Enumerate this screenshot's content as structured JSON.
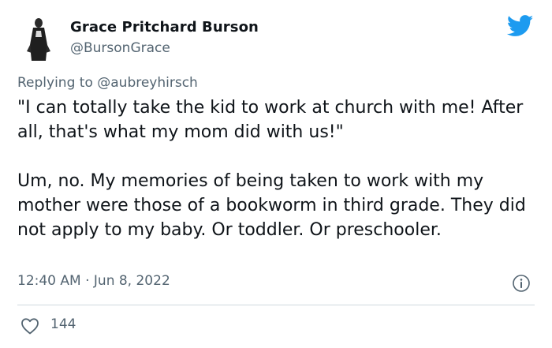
{
  "author": {
    "name": "Grace Pritchard Burson",
    "handle": "@BursonGrace"
  },
  "reply": {
    "prefix": "Replying to ",
    "mention": "@aubreyhirsch"
  },
  "tweet": {
    "paragraph_1": "\"I can totally take the kid to work at church with me! After all, that's what my mom did with us!\"",
    "paragraph_2": "Um, no. My memories of being taken to work with my mother were those of a bookworm in third grade. They did not apply to my baby. Or toddler. Or preschooler.",
    "timestamp": "12:40 AM · Jun 8, 2022"
  },
  "stats": {
    "likes": "144"
  },
  "icons": {
    "brand": "twitter-bird-icon",
    "info": "info-icon",
    "like": "heart-icon"
  },
  "colors": {
    "brand_blue": "#1d9bf0",
    "secondary_text": "#536471",
    "primary_text": "#0f1419"
  }
}
